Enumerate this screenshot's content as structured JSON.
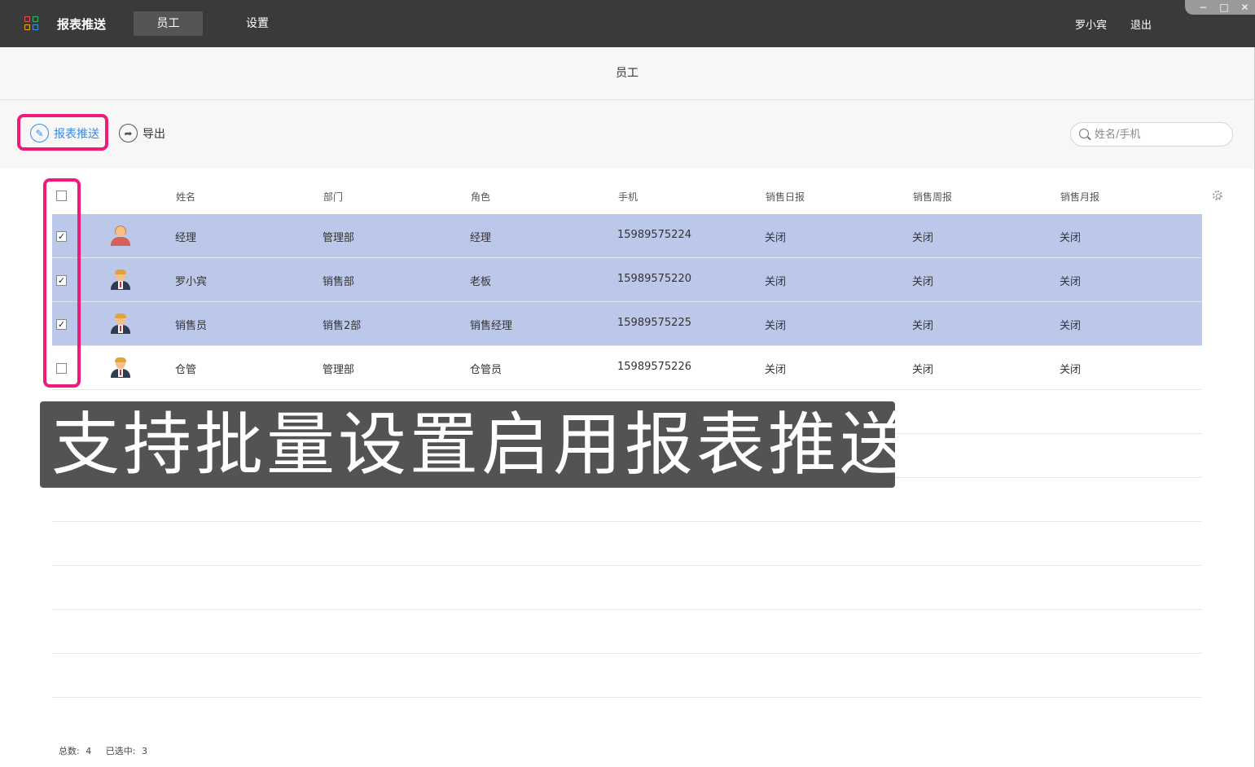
{
  "topbar": {
    "app_title": "报表推送",
    "nav": [
      {
        "label": "员工",
        "active": true
      },
      {
        "label": "设置",
        "active": false
      }
    ],
    "user_name": "罗小宾",
    "logout": "退出",
    "window_controls": {
      "minimize": "−",
      "maximize": "□",
      "close": "✕"
    }
  },
  "page": {
    "title": "员工"
  },
  "toolbar": {
    "push_label": "报表推送",
    "export_label": "导出",
    "search_placeholder": "姓名/手机"
  },
  "table": {
    "columns": [
      "姓名",
      "部门",
      "角色",
      "手机",
      "销售日报",
      "销售周报",
      "销售月报"
    ],
    "rows": [
      {
        "name": "经理",
        "dept": "管理部",
        "role": "经理",
        "phone": "15989575224",
        "daily": "关闭",
        "weekly": "关闭",
        "monthly": "关闭",
        "checked": true,
        "avatar": "female"
      },
      {
        "name": "罗小宾",
        "dept": "销售部",
        "role": "老板",
        "phone": "15989575220",
        "daily": "关闭",
        "weekly": "关闭",
        "monthly": "关闭",
        "checked": true,
        "avatar": "male"
      },
      {
        "name": "销售员",
        "dept": "销售2部",
        "role": "销售经理",
        "phone": "15989575225",
        "daily": "关闭",
        "weekly": "关闭",
        "monthly": "关闭",
        "checked": true,
        "avatar": "male"
      },
      {
        "name": "仓管",
        "dept": "管理部",
        "role": "仓管员",
        "phone": "15989575226",
        "daily": "关闭",
        "weekly": "关闭",
        "monthly": "关闭",
        "checked": false,
        "avatar": "male"
      }
    ]
  },
  "footer": {
    "total_label": "总数:",
    "total_value": "4",
    "selected_label": "已选中:",
    "selected_value": "3"
  },
  "caption": "支持批量设置启用报表推送",
  "colors": {
    "topbar": "#3a3a3a",
    "selected_row": "#bcc8ea",
    "highlight": "#ef1b7a",
    "link": "#3c8be0"
  }
}
